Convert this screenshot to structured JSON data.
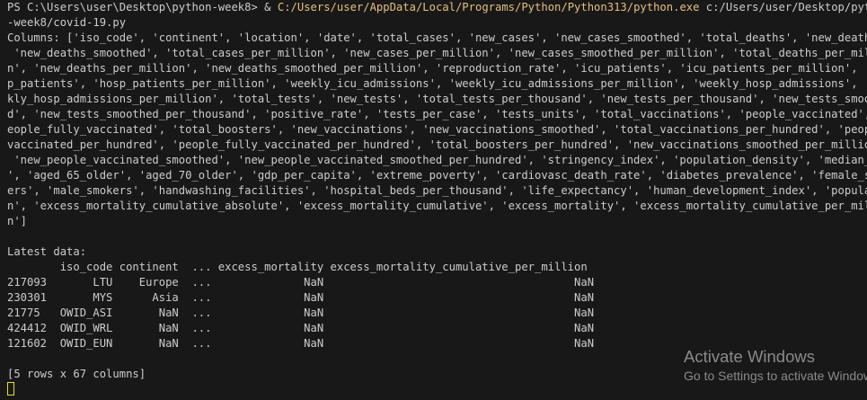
{
  "terminal": {
    "command": {
      "prompt": "PS C:\\Users\\user\\Desktop\\python-week8> ",
      "operator": "& ",
      "executable": "C:/Users/user/AppData/Local/Programs/Python/Python313/python.exe",
      "argument_part1": " c:/Users/user/Desktop/python",
      "argument_part2": "-week8/covid-19.py"
    },
    "columns_output": [
      "Columns: ['iso_code', 'continent', 'location', 'date', 'total_cases', 'new_cases', 'new_cases_smoothed', 'total_deaths', 'new_deaths',",
      " 'new_deaths_smoothed', 'total_cases_per_million', 'new_cases_per_million', 'new_cases_smoothed_per_million', 'total_deaths_per_millio",
      "n', 'new_deaths_per_million', 'new_deaths_smoothed_per_million', 'reproduction_rate', 'icu_patients', 'icu_patients_per_million', 'hos",
      "p_patients', 'hosp_patients_per_million', 'weekly_icu_admissions', 'weekly_icu_admissions_per_million', 'weekly_hosp_admissions', 'wee",
      "kly_hosp_admissions_per_million', 'total_tests', 'new_tests', 'total_tests_per_thousand', 'new_tests_per_thousand', 'new_tests_smoothe",
      "d', 'new_tests_smoothed_per_thousand', 'positive_rate', 'tests_per_case', 'tests_units', 'total_vaccinations', 'people_vaccinated', 'p",
      "eople_fully_vaccinated', 'total_boosters', 'new_vaccinations', 'new_vaccinations_smoothed', 'total_vaccinations_per_hundred', 'people_",
      "vaccinated_per_hundred', 'people_fully_vaccinated_per_hundred', 'total_boosters_per_hundred', 'new_vaccinations_smoothed_per_million',",
      " 'new_people_vaccinated_smoothed', 'new_people_vaccinated_smoothed_per_hundred', 'stringency_index', 'population_density', 'median_age",
      "', 'aged_65_older', 'aged_70_older', 'gdp_per_capita', 'extreme_poverty', 'cardiovasc_death_rate', 'diabetes_prevalence', 'female_smok",
      "ers', 'male_smokers', 'handwashing_facilities', 'hospital_beds_per_thousand', 'life_expectancy', 'human_development_index', 'populatio",
      "n', 'excess_mortality_cumulative_absolute', 'excess_mortality_cumulative', 'excess_mortality', 'excess_mortality_cumulative_per_millio",
      "n']"
    ],
    "blank": "",
    "latest_label": "Latest data:",
    "table": {
      "header": "        iso_code continent  ... excess_mortality excess_mortality_cumulative_per_million",
      "rows": [
        "217093       LTU    Europe  ...              NaN                                      NaN",
        "230301       MYS      Asia  ...              NaN                                      NaN",
        "21775   OWID_ASI       NaN  ...              NaN                                      NaN",
        "424412  OWID_WRL       NaN  ...              NaN                                      NaN",
        "121602  OWID_EUN       NaN  ...              NaN                                      NaN"
      ]
    },
    "summary": "[5 rows x 67 columns]"
  },
  "watermark": {
    "title": "Activate Windows",
    "subtitle": "Go to Settings to activate Windows."
  },
  "colors": {
    "background": "#181818",
    "text": "#cccccc",
    "path_highlight": "#e5c07b",
    "cursor": "#e5e510"
  }
}
